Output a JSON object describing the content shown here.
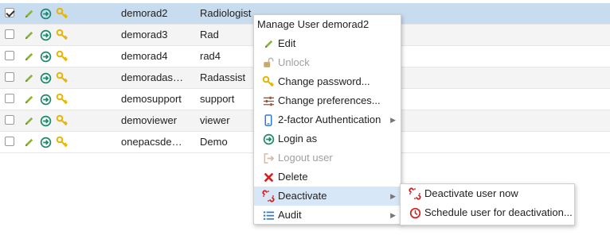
{
  "table": {
    "rows": [
      {
        "checked": true,
        "username": "demorad2",
        "name": "Radiologist",
        "state": "selected"
      },
      {
        "checked": false,
        "username": "demorad3",
        "name": "Rad",
        "state": "alt"
      },
      {
        "checked": false,
        "username": "demorad4",
        "name": "rad4",
        "state": ""
      },
      {
        "checked": false,
        "username": "demoradas…",
        "name": "Radassist",
        "state": "alt"
      },
      {
        "checked": false,
        "username": "demosupport",
        "name": "support",
        "state": ""
      },
      {
        "checked": false,
        "username": "demoviewer",
        "name": "viewer",
        "state": "alt"
      },
      {
        "checked": false,
        "username": "onepacsde…",
        "name": "Demo",
        "state": ""
      }
    ]
  },
  "context_menu": {
    "title": "Manage User demorad2",
    "items": [
      {
        "label": "Edit",
        "icon": "pencil-icon",
        "disabled": false,
        "submenu": false
      },
      {
        "label": "Unlock",
        "icon": "unlock-icon",
        "disabled": true,
        "submenu": false
      },
      {
        "label": "Change password...",
        "icon": "key-icon",
        "disabled": false,
        "submenu": false
      },
      {
        "label": "Change preferences...",
        "icon": "sliders-icon",
        "disabled": false,
        "submenu": false
      },
      {
        "label": "2-factor Authentication",
        "icon": "phone-icon",
        "disabled": false,
        "submenu": true
      },
      {
        "label": "Login as",
        "icon": "login-icon",
        "disabled": false,
        "submenu": false
      },
      {
        "label": "Logout user",
        "icon": "logout-icon",
        "disabled": true,
        "submenu": false
      },
      {
        "label": "Delete",
        "icon": "delete-x-icon",
        "disabled": false,
        "submenu": false
      },
      {
        "label": "Deactivate",
        "icon": "broken-link-icon",
        "disabled": false,
        "submenu": true,
        "highlighted": true
      },
      {
        "label": "Audit",
        "icon": "list-icon",
        "disabled": false,
        "submenu": true
      }
    ]
  },
  "deactivate_submenu": {
    "items": [
      {
        "label": "Deactivate user now",
        "icon": "broken-link-icon"
      },
      {
        "label": "Schedule user for deactivation...",
        "icon": "clock-icon"
      }
    ]
  },
  "colors": {
    "selected_row": "#c8dcf0",
    "menu_highlight": "#d7e7f7",
    "edit_icon": "#8db33a",
    "login_icon": "#1b8a6b",
    "key_icon": "#e8b400",
    "delete_icon": "#e01b1b"
  }
}
